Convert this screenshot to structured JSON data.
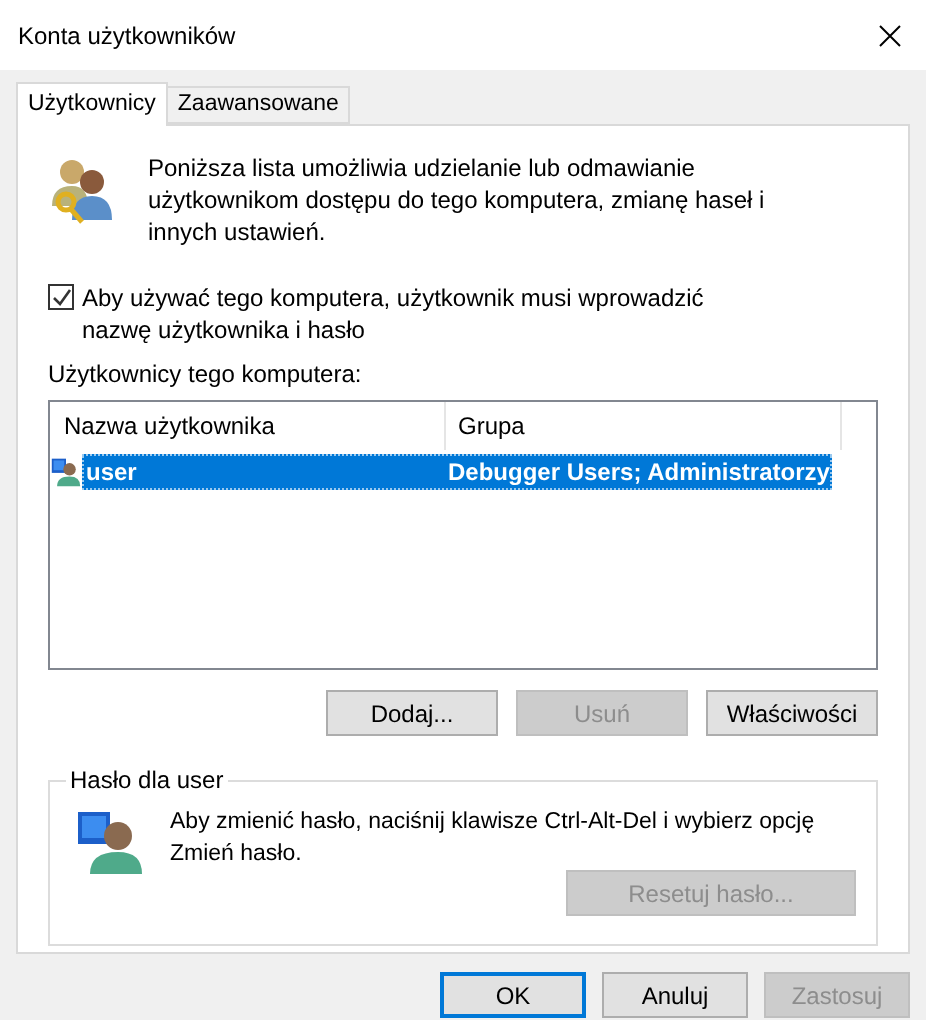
{
  "window": {
    "title": "Konta użytkowników"
  },
  "tabs": [
    {
      "label": "Użytkownicy",
      "selected": true
    },
    {
      "label": "Zaawansowane",
      "selected": false
    }
  ],
  "intro": "Poniższa lista umożliwia udzielanie lub odmawianie użytkownikom dostępu do tego komputera, zmianę haseł i innych ustawień.",
  "require_login": {
    "label": "Aby używać tego komputera, użytkownik musi wprowadzić nazwę użytkownika i hasło",
    "checked": true
  },
  "users_label": "Użytkownicy tego komputera:",
  "table": {
    "columns": [
      "Nazwa użytkownika",
      "Grupa"
    ],
    "rows": [
      {
        "name": "user",
        "group": "Debugger Users; Administratorzy",
        "selected": true
      }
    ]
  },
  "list_buttons": [
    {
      "label": "Dodaj...",
      "disabled": false
    },
    {
      "label": "Usuń",
      "disabled": true
    },
    {
      "label": "Właściwości",
      "disabled": false
    }
  ],
  "password": {
    "title": "Hasło dla user",
    "text": "Aby zmienić hasło, naciśnij klawisze Ctrl-Alt-Del i wybierz opcję Zmień hasło.",
    "button": {
      "label": "Resetuj hasło...",
      "disabled": true
    }
  },
  "footer_buttons": [
    {
      "label": "OK",
      "disabled": false,
      "default": true
    },
    {
      "label": "Anuluj",
      "disabled": false,
      "default": false
    },
    {
      "label": "Zastosuj",
      "disabled": true,
      "default": false
    }
  ]
}
